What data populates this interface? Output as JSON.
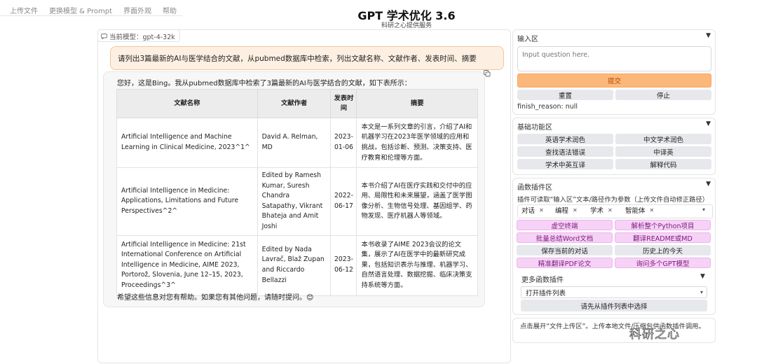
{
  "nav": {
    "items": [
      "上传文件",
      "更换模型 & Prompt",
      "界面外观",
      "帮助"
    ]
  },
  "header": {
    "title": "GPT 学术优化 3.6",
    "subtitle": "科研之心提供服务"
  },
  "model_badge": {
    "label": "当前模型：gpt-4-32k"
  },
  "chat": {
    "user_message": "请列出3篇最新的AI与医学结合的文献，从pubmed数据库中检索，列出文献名称、文献作者、发表时间、摘要",
    "bot_intro": "您好，这是Bing。我从pubmed数据库中检索了3篇最新的AI与医学结合的文献，如下表所示：",
    "bot_outro": "希望这些信息对您有帮助。如果您有其他问题，请随时提问。😊",
    "table": {
      "headers": [
        "文献名称",
        "文献作者",
        "发表时间",
        "摘要"
      ],
      "rows": [
        {
          "name": "Artificial Intelligence and Machine Learning in Clinical Medicine, 2023^1^",
          "author": "David A. Relman, MD",
          "date": "2023-01-06",
          "abstract": "本文是一系列文章的引言，介绍了AI和机器学习在2023年医学领域的应用和挑战，包括诊断、预测、决策支持、医疗教育和伦理等方面。"
        },
        {
          "name": "Artificial Intelligence in Medicine: Applications, Limitations and Future Perspectives^2^",
          "author": "Edited by Ramesh Kumar, Suresh Chandra Satapathy, Vikrant Bhateja and Amit Joshi",
          "date": "2022-06-17",
          "abstract": "本书介绍了AI在医疗实践和交付中的应用、局限性和未来展望，涵盖了医学图像分析、生物信号处理、基因组学、药物发现、医疗机器人等领域。"
        },
        {
          "name": "Artificial Intelligence in Medicine: 21st International Conference on Artificial Intelligence in Medicine, AIME 2023, Portorož, Slovenia, June 12–15, 2023, Proceedings^3^",
          "author": "Edited by Nada Lavrač, Blaž Zupan and Riccardo Bellazzi",
          "date": "2023-06-12",
          "abstract": "本书收录了AIME 2023会议的论文集，展示了AI在医学中的最新研究成果，包括知识表示与推理、机器学习、自然语言处理、数据挖掘、临床决策支持系统等方面。"
        }
      ]
    }
  },
  "input_panel": {
    "title": "输入区",
    "placeholder": "Input question here.",
    "submit": "提交",
    "reset": "重置",
    "stop": "停止",
    "finish_reason": "finish_reason: null"
  },
  "basic_panel": {
    "title": "基础功能区",
    "buttons": [
      "英语学术润色",
      "中文学术润色",
      "查找语法错误",
      "中译英",
      "学术中英互译",
      "解释代码"
    ]
  },
  "plugin_panel": {
    "title": "函数插件区",
    "hint": "插件可读取“输入区”文本/路径作为参数（上传文件自动修正路径）",
    "tags": [
      "对话",
      "编程",
      "学术",
      "智能体"
    ],
    "buttons": [
      "虚空终端",
      "解析整个Python项目",
      "批量总结Word文档",
      "翻译README或MD",
      "保存当前的对话",
      "历史上的今天",
      "精准翻译PDF论文",
      "询问多个GPT模型"
    ],
    "more_title": "更多函数插件",
    "select_value": "打开插件列表",
    "select_button": "请先从插件列表中选择"
  },
  "upload_panel": {
    "text": "点击展开“文件上传区”。上传本地文件/压缩包供函数插件调用。"
  },
  "watermark": "科研之心"
}
